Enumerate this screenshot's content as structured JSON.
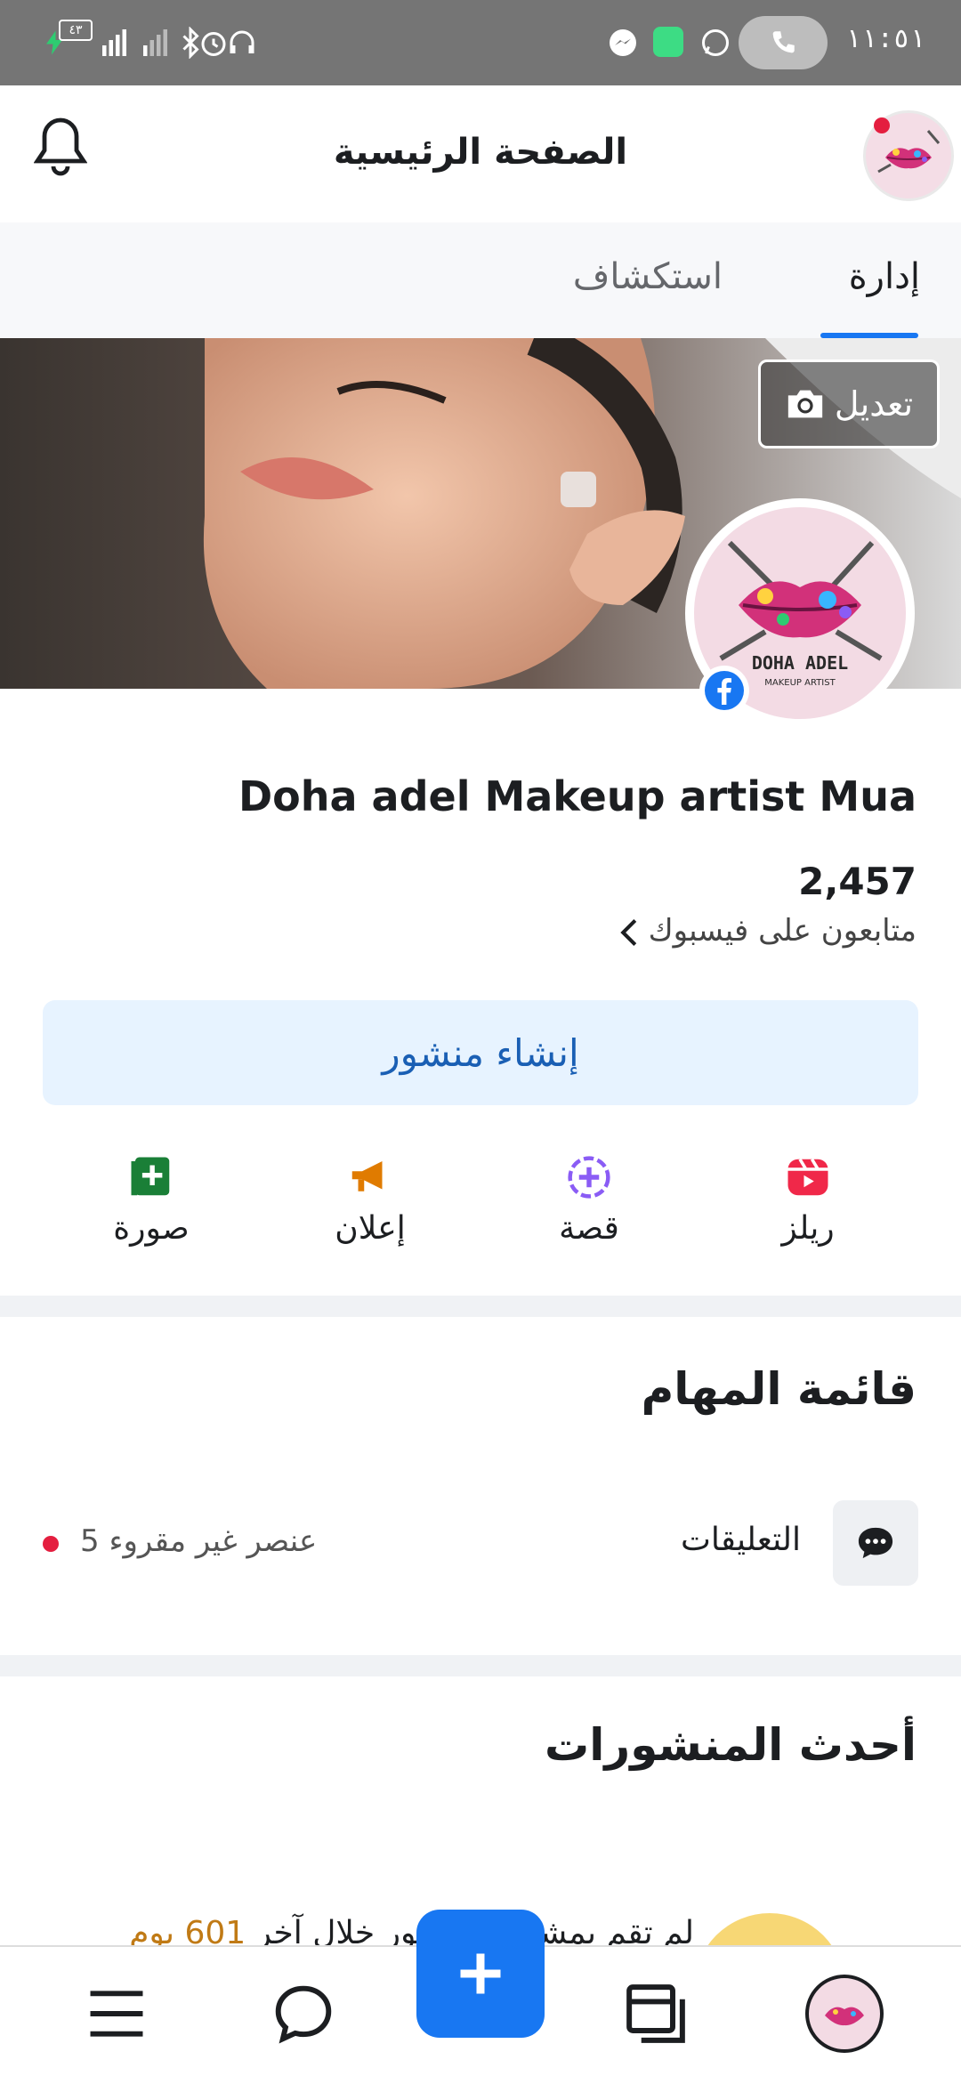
{
  "status_bar": {
    "time": "١١:٥١",
    "battery": "٤٣"
  },
  "header": {
    "title": "الصفحة الرئيسية"
  },
  "tabs": [
    {
      "label": "إدارة",
      "active": true
    },
    {
      "label": "استكشاف",
      "active": false
    }
  ],
  "cover": {
    "edit_label": "تعديل"
  },
  "profile": {
    "name": "Doha adel Makeup artist Mua",
    "logo_text": "DOHA ADEL",
    "logo_subtext": "MAKEUP ARTIST",
    "followers_count": "2,457",
    "followers_label": "متابعون على فيسبوك"
  },
  "create_post": {
    "label": "إنشاء منشور"
  },
  "actions": [
    {
      "label": "ريلز",
      "icon": "reels-icon",
      "color": "#f02849"
    },
    {
      "label": "قصة",
      "icon": "story-icon",
      "color": "#8a5cf5"
    },
    {
      "label": "إعلان",
      "icon": "megaphone-icon",
      "color": "#e07b00"
    },
    {
      "label": "صورة",
      "icon": "photo-icon",
      "color": "#1a7f37"
    }
  ],
  "tasks": {
    "title": "قائمة المهام",
    "items": [
      {
        "label": "التعليقات",
        "status": "5 عنصر غير مقروء",
        "icon": "comment-icon"
      }
    ]
  },
  "recent_posts": {
    "title": "أحدث المنشورات",
    "preview_text": "لم تقم بمشاركة منشور خلال آخر",
    "preview_days": "601 يوم"
  },
  "colors": {
    "accent": "#1877f2",
    "create_post_bg": "#e7f3ff",
    "unread": "#e41e3f"
  }
}
